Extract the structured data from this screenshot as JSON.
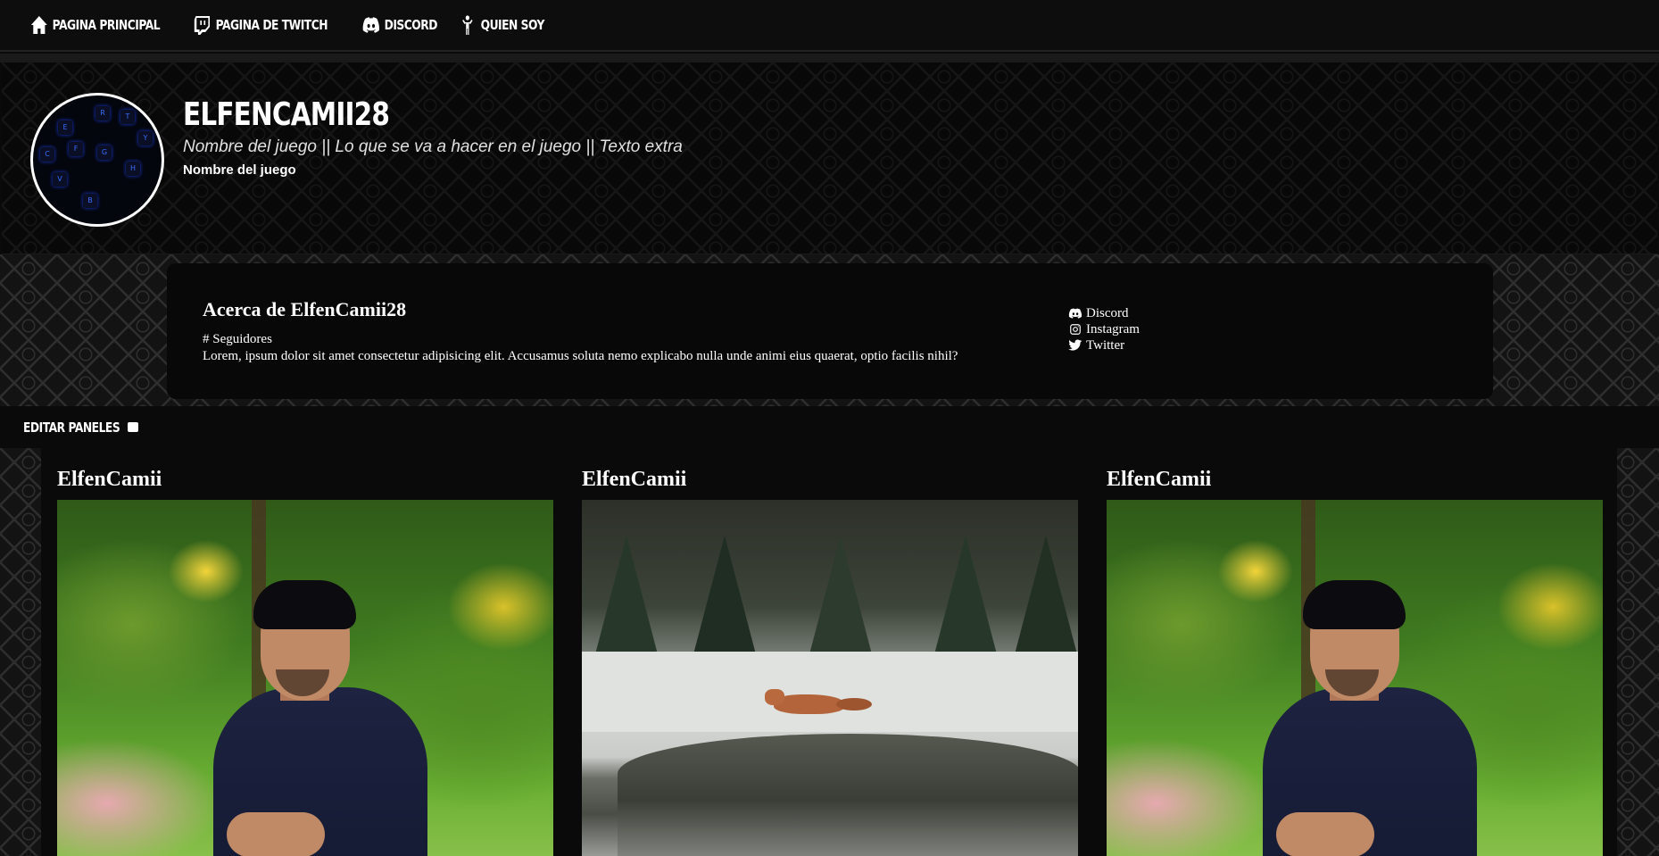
{
  "nav": {
    "items": [
      {
        "label": "PAGINA PRINCIPAL",
        "icon": "home-icon"
      },
      {
        "label": "PAGINA DE TWITCH",
        "icon": "twitch-icon"
      },
      {
        "label": "DISCORD",
        "icon": "discord-icon"
      },
      {
        "label": "QUIEN SOY",
        "icon": "person-icon"
      }
    ]
  },
  "header": {
    "channel_name": "ELFENCAMII28",
    "stream_title": "Nombre del juego || Lo que se va a hacer en el juego || Texto extra",
    "game_name": "Nombre del juego"
  },
  "about": {
    "title": "Acerca de ElfenCamii28",
    "followers": "# Seguidores",
    "bio": "Lorem, ipsum dolor sit amet consectetur adipisicing elit. Accusamus soluta nemo explicabo nulla unde animi eius quaerat, optio facilis nihil?",
    "socials": [
      {
        "label": "Discord",
        "icon": "discord-icon"
      },
      {
        "label": "Instagram",
        "icon": "instagram-icon"
      },
      {
        "label": "Twitter",
        "icon": "twitter-icon"
      }
    ]
  },
  "edit_panels": {
    "label": "EDITAR PANELES",
    "checked": true
  },
  "panels": [
    {
      "title": "ElfenCamii",
      "image": "man-portrait-photo"
    },
    {
      "title": "ElfenCamii",
      "image": "fox-snow-photo"
    },
    {
      "title": "ElfenCamii",
      "image": "man-portrait-photo"
    }
  ],
  "colors": {
    "background": "#0a0a0a",
    "text": "#ffffff",
    "avatar_accent": "#3a6dff"
  }
}
